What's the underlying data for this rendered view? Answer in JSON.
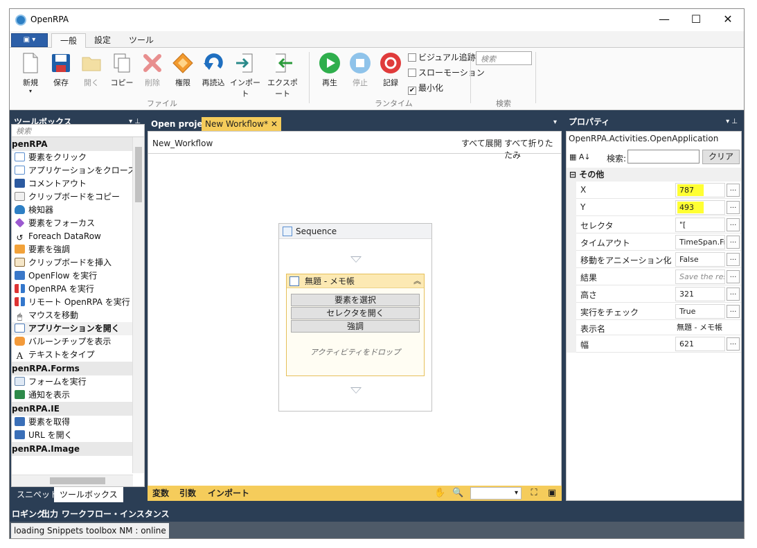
{
  "window": {
    "title": "OpenRPA",
    "minimize": "—",
    "maximize": "☐",
    "close": "✕"
  },
  "ribbon": {
    "tabs": [
      "一般",
      "設定",
      "ツール"
    ],
    "active_tab": "一般",
    "file_group": {
      "label": "ファイル",
      "buttons": [
        "新規",
        "保存",
        "開く",
        "コピー",
        "削除",
        "権限",
        "再読込",
        "インポート",
        "エクスポート"
      ]
    },
    "runtime_group": {
      "label": "ランタイム",
      "buttons": [
        "再生",
        "停止",
        "記録"
      ],
      "checkboxes": [
        {
          "label": "ビジュアル追跡",
          "checked": false
        },
        {
          "label": "スローモーション",
          "checked": false
        },
        {
          "label": "最小化",
          "checked": true
        }
      ]
    },
    "search_group": {
      "label": "検索",
      "placeholder": "検索"
    }
  },
  "toolbox": {
    "header": "ツールボックス",
    "search_placeholder": "検索",
    "categories": [
      {
        "name": "penRPA",
        "items": [
          "要素をクリック",
          "アプリケーションをクローズ",
          "コメントアウト",
          "クリップボードをコピー",
          "検知器",
          "要素をフォーカス",
          "Foreach DataRow",
          "要素を強調",
          "クリップボードを挿入",
          "OpenFlow を実行",
          "OpenRPA を実行",
          "リモート OpenRPA を実行",
          "マウスを移動",
          "アプリケーションを開く",
          "バルーンチップを表示",
          "テキストをタイプ"
        ]
      },
      {
        "name": "penRPA.Forms",
        "items": [
          "フォームを実行",
          "通知を表示"
        ]
      },
      {
        "name": "penRPA.IE",
        "items": [
          "要素を取得",
          "URL を開く"
        ]
      },
      {
        "name": "penRPA.Image",
        "items": []
      }
    ],
    "selected_item": "アプリケーションを開く",
    "bottom_tabs": [
      "スニペット",
      "ツールボックス"
    ],
    "active_bottom_tab": "ツールボックス"
  },
  "designer": {
    "tabs": [
      "Open project",
      "New Workflow*"
    ],
    "active_tab": "New Workflow*",
    "breadcrumb": "New_Workflow",
    "expand_all": "すべて展開",
    "collapse_all": "すべて折りたたみ",
    "sequence_title": "Sequence",
    "activity_title": "無題 - メモ帳",
    "activity_buttons": [
      "要素を選択",
      "セレクタを開く",
      "強調"
    ],
    "drop_hint": "アクティビティをドロップ",
    "bottom_tabs": [
      "変数",
      "引数",
      "インポート"
    ]
  },
  "properties": {
    "header": "プロパティ",
    "type_name": "OpenRPA.Activities.OpenApplication",
    "search_label": "検索:",
    "clear_label": "クリア",
    "category": "その他",
    "rows": [
      {
        "name": "X",
        "value": "787",
        "highlight": true,
        "button": true
      },
      {
        "name": "Y",
        "value": "493",
        "highlight": true,
        "button": true
      },
      {
        "name": "セレクタ",
        "value": "\"[",
        "button": true
      },
      {
        "name": "タイムアウト",
        "value": "TimeSpan.Fr",
        "button": true
      },
      {
        "name": "移動をアニメーション化",
        "value": "False",
        "button": true
      },
      {
        "name": "結果",
        "value": "Save the res",
        "italic": true,
        "button": true
      },
      {
        "name": "高さ",
        "value": "321",
        "button": true
      },
      {
        "name": "実行をチェック",
        "value": "True",
        "button": true
      },
      {
        "name": "表示名",
        "value": "無題 - メモ帳",
        "plain": true,
        "button": false
      },
      {
        "name": "幅",
        "value": "621",
        "button": true
      }
    ]
  },
  "output_tabs": [
    "ロギング",
    "出力",
    "ワークフロー・インスタンス"
  ],
  "status": {
    "text": "loading Snippets toolbox    NM : online"
  },
  "colors": {
    "chrome": "#2b3e55",
    "active_tab": "#f5cc5b",
    "highlight": "#ffff33"
  }
}
